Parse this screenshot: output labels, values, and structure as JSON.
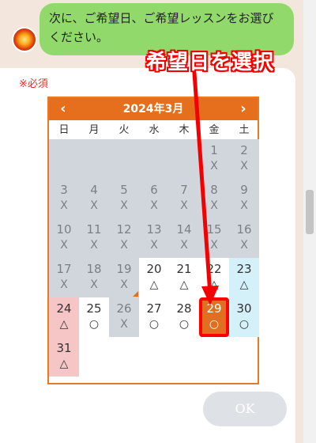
{
  "message": {
    "text": "次に、ご希望日、ご希望レッスンをお選びください。"
  },
  "form": {
    "required_label": "※必須",
    "ok_label": "OK"
  },
  "annotation": {
    "text": "希望日を選択"
  },
  "calendar": {
    "title": "2024年3月",
    "prev_label": "‹",
    "next_label": "›",
    "weekdays": [
      "日",
      "月",
      "火",
      "水",
      "木",
      "金",
      "土"
    ],
    "days": [
      {
        "day": "1",
        "mark": "X"
      },
      {
        "day": "2",
        "mark": "X"
      },
      {
        "day": "3",
        "mark": "X"
      },
      {
        "day": "4",
        "mark": "X"
      },
      {
        "day": "5",
        "mark": "X"
      },
      {
        "day": "6",
        "mark": "X"
      },
      {
        "day": "7",
        "mark": "X"
      },
      {
        "day": "8",
        "mark": "X"
      },
      {
        "day": "9",
        "mark": "X"
      },
      {
        "day": "10",
        "mark": "X"
      },
      {
        "day": "11",
        "mark": "X"
      },
      {
        "day": "12",
        "mark": "X"
      },
      {
        "day": "13",
        "mark": "X"
      },
      {
        "day": "14",
        "mark": "X"
      },
      {
        "day": "15",
        "mark": "X"
      },
      {
        "day": "16",
        "mark": "X"
      },
      {
        "day": "17",
        "mark": "X"
      },
      {
        "day": "18",
        "mark": "X"
      },
      {
        "day": "19",
        "mark": "X"
      },
      {
        "day": "20",
        "mark": "△"
      },
      {
        "day": "21",
        "mark": "△"
      },
      {
        "day": "22",
        "mark": "△"
      },
      {
        "day": "23",
        "mark": "△"
      },
      {
        "day": "24",
        "mark": "△"
      },
      {
        "day": "25",
        "mark": "○"
      },
      {
        "day": "26",
        "mark": "X"
      },
      {
        "day": "27",
        "mark": "○"
      },
      {
        "day": "28",
        "mark": "○"
      },
      {
        "day": "29",
        "mark": "○"
      },
      {
        "day": "30",
        "mark": "○"
      },
      {
        "day": "31",
        "mark": "△"
      }
    ],
    "selected_day": "29"
  },
  "colors": {
    "accent": "#e56f1c",
    "bubble": "#92d96c",
    "annotation": "#f30000"
  }
}
